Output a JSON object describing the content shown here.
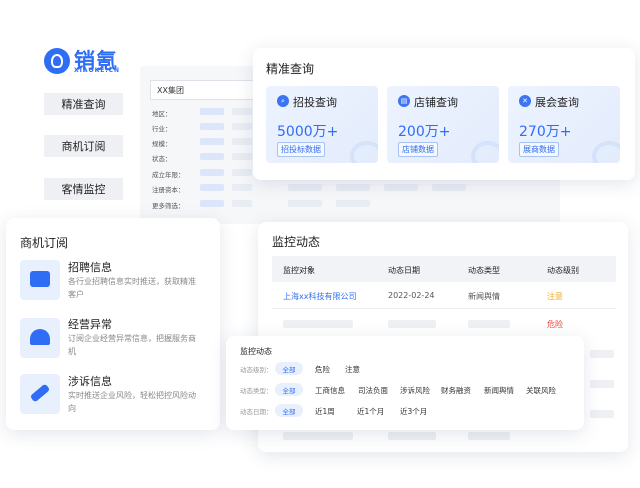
{
  "brand": {
    "name": "销氪",
    "sub": "XIAOKE.CN"
  },
  "nav": [
    "精准查询",
    "商机订阅",
    "客情监控"
  ],
  "search": {
    "value": "XX集团",
    "filters": [
      "地区：",
      "行业：",
      "规模：",
      "状态：",
      "成立年限：",
      "注册资本：",
      "更多筛选："
    ]
  },
  "precise": {
    "title": "精准查询",
    "cards": [
      {
        "icon": "search-icon",
        "label": "招投查询",
        "value": "5000万+",
        "tag": "招投标数据"
      },
      {
        "icon": "store-icon",
        "label": "店铺查询",
        "value": "200万+",
        "tag": "店铺数据"
      },
      {
        "icon": "exhibition-icon",
        "label": "展会查询",
        "value": "270万+",
        "tag": "展商数据"
      }
    ]
  },
  "subscribe": {
    "title": "商机订阅",
    "items": [
      {
        "icon": "toolbox-icon",
        "name": "招聘信息",
        "desc": "各行业招聘信息实时推送，获取精准客户"
      },
      {
        "icon": "alarm-icon",
        "name": "经营异常",
        "desc": "订阅企业经营异常信息，把握服务商机"
      },
      {
        "icon": "gavel-icon",
        "name": "涉诉信息",
        "desc": "实时推送企业风险，轻松把控风险动向"
      }
    ]
  },
  "monitor": {
    "title": "监控动态",
    "columns": [
      "监控对象",
      "动态日期",
      "动态类型",
      "动态级别"
    ],
    "rows": [
      {
        "target": "上海xx科技有限公司",
        "date": "2022-02-24",
        "type": "新闻舆情",
        "level": "注意"
      },
      {
        "level": "危险"
      }
    ],
    "colors": {
      "link": "#2f6df5",
      "warn": "#f5a623",
      "danger": "#e8453c"
    }
  },
  "filter": {
    "title": "监控动态",
    "rows": [
      {
        "label": "动态级别：",
        "all": "全部",
        "options": [
          "危险",
          "注意"
        ]
      },
      {
        "label": "动态类型：",
        "all": "全部",
        "options": [
          "工商信息",
          "司法负面",
          "涉诉风险",
          "财务融资",
          "新闻舆情",
          "关联风险"
        ]
      },
      {
        "label": "动态日期：",
        "all": "全部",
        "options": [
          "近1周",
          "近1个月",
          "近3个月"
        ]
      }
    ]
  }
}
